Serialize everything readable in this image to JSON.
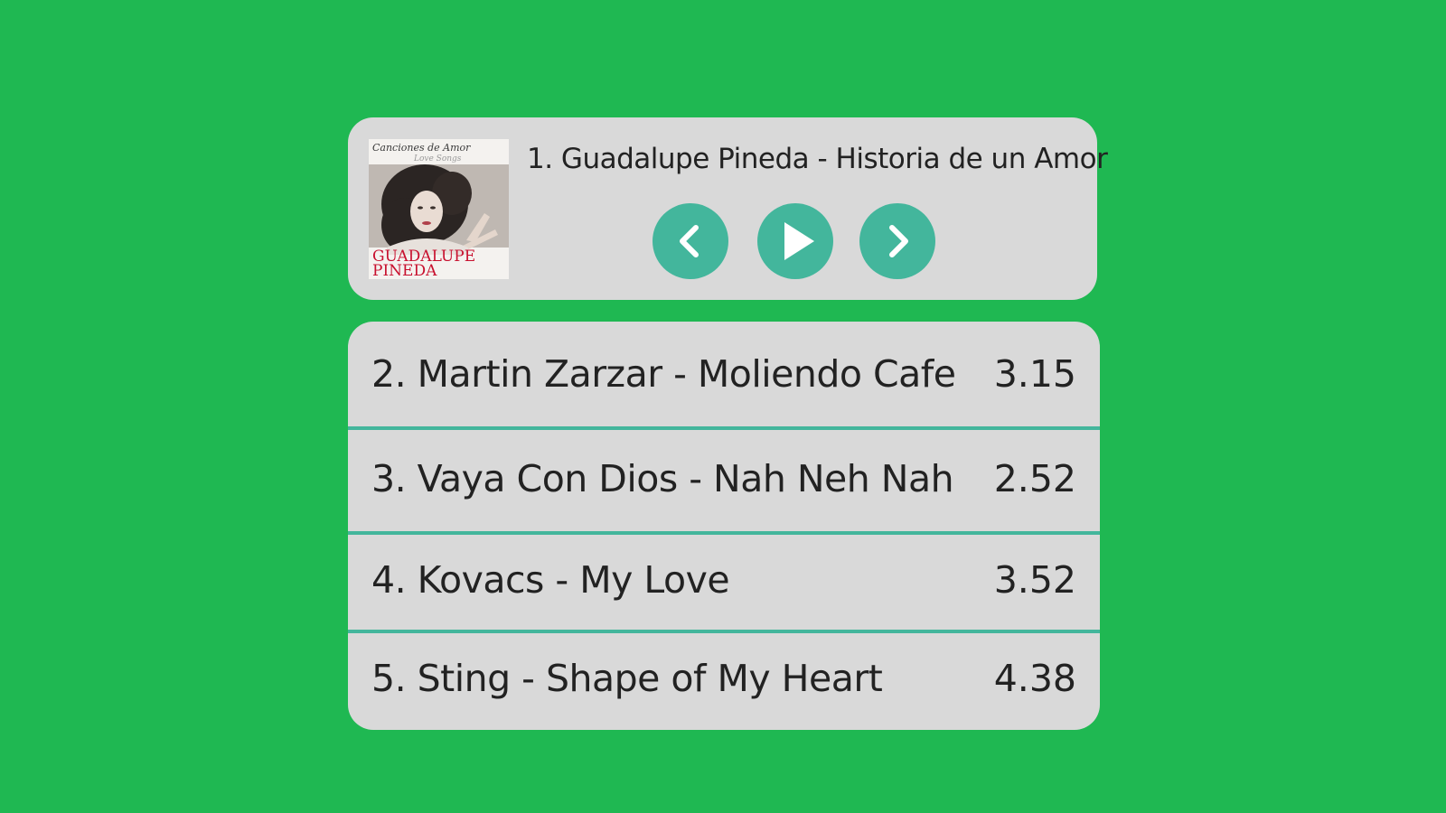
{
  "player": {
    "album_cover": {
      "top_text": "Canciones de Amor",
      "script_text": "Love Songs",
      "artist_line1": "GUADALUPE",
      "artist_line2": "PINEDA"
    },
    "now_playing": "1. Guadalupe Pineda - Historia de un Amor",
    "controls": {
      "prev_icon": "chevron-left-icon",
      "play_icon": "play-icon",
      "next_icon": "chevron-right-icon"
    }
  },
  "playlist": [
    {
      "title": "2. Martin Zarzar - Moliendo Cafe",
      "duration": "3.15"
    },
    {
      "title": "3. Vaya Con Dios - Nah Neh Nah",
      "duration": "2.52"
    },
    {
      "title": "4. Kovacs - My Love",
      "duration": "3.52"
    },
    {
      "title": "5. Sting - Shape of My Heart",
      "duration": "4.38"
    }
  ],
  "colors": {
    "background": "#1fb852",
    "card": "#d9d9d9",
    "accent": "#43b69c",
    "text": "#222222",
    "cover_title": "#c8102e"
  }
}
